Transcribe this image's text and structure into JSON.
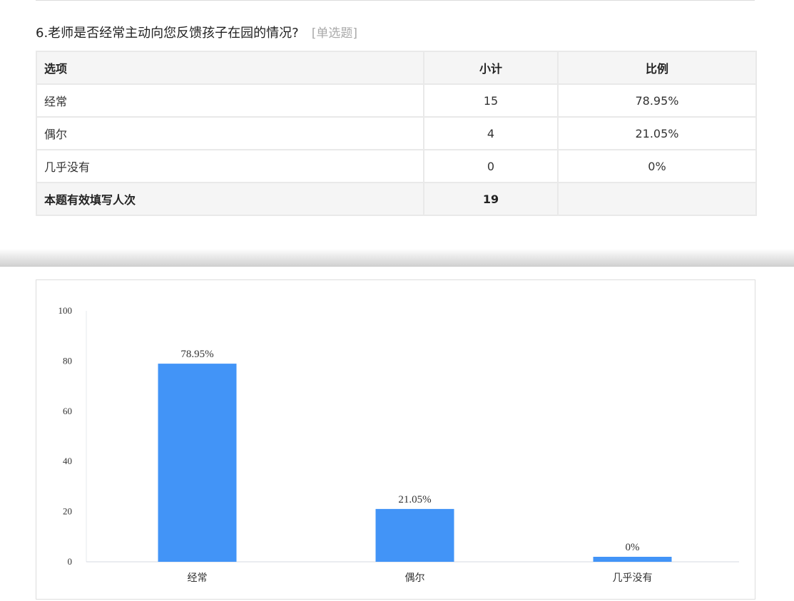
{
  "question": {
    "title": "6.老师是否经常主动向您反馈孩子在园的情况?",
    "type_label": "[单选题]"
  },
  "table": {
    "headers": [
      "选项",
      "小计",
      "比例"
    ],
    "rows": [
      {
        "option": "经常",
        "count": "15",
        "ratio": "78.95%"
      },
      {
        "option": "偶尔",
        "count": "4",
        "ratio": "21.05%"
      },
      {
        "option": "几乎没有",
        "count": "0",
        "ratio": "0%"
      }
    ],
    "total": {
      "label": "本题有效填写人次",
      "count": "19",
      "ratio": ""
    }
  },
  "chart_data": {
    "type": "bar",
    "categories": [
      "经常",
      "偶尔",
      "几乎没有"
    ],
    "values": [
      78.95,
      21.05,
      0
    ],
    "data_labels": [
      "78.95%",
      "21.05%",
      "0%"
    ],
    "ylim": [
      0,
      100
    ],
    "yticks": [
      0,
      20,
      40,
      60,
      80,
      100
    ],
    "title": "",
    "xlabel": "",
    "ylabel": "",
    "grid": false,
    "bar_color": "#4294f7"
  }
}
